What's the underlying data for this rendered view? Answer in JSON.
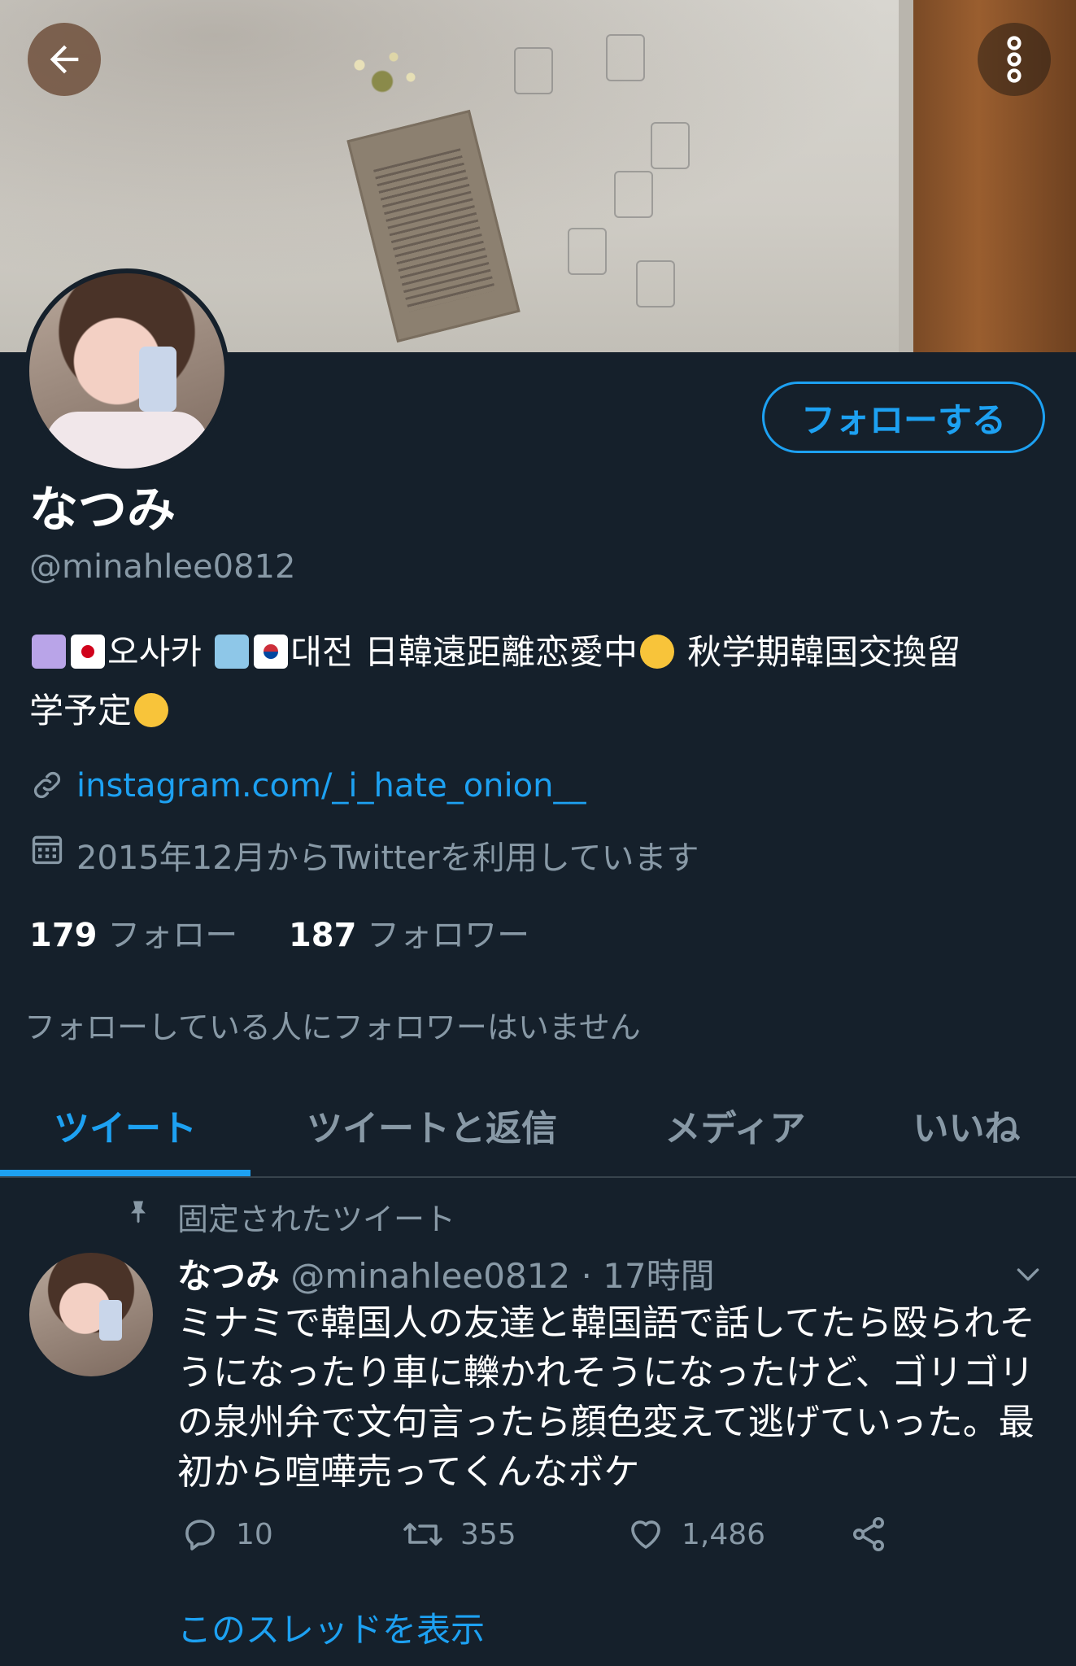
{
  "profile": {
    "name": "なつみ",
    "handle": "@minahlee0812",
    "bio_line1": "오사카 ",
    "bio_line1b": "대전 日韓遠距離恋愛中",
    "bio_line1c": " 秋学期韓国交換留",
    "bio_line2": "学予定",
    "link": "instagram.com/_i_hate_onion__",
    "joined": "2015年12月からTwitterを利用しています",
    "follow_button": "フォローする",
    "following_count": "179",
    "following_label": "フォロー",
    "followers_count": "187",
    "followers_label": "フォロワー",
    "mutual_note": "フォローしている人にフォロワーはいません"
  },
  "tabs": [
    {
      "label": "ツイート"
    },
    {
      "label": "ツイートと返信"
    },
    {
      "label": "メディア"
    },
    {
      "label": "いいね"
    }
  ],
  "tweet": {
    "pinned_label": "固定されたツイート",
    "name": "なつみ",
    "handle_time": " @minahlee0812 · 17時間",
    "text": "ミナミで韓国人の友達と韓国語で話してたら殴られそうになったり車に轢かれそうになったけど、ゴリゴリの泉州弁で文句言ったら顔色変えて逃げていった。最初から喧嘩売ってくんなボケ",
    "replies": "10",
    "retweets": "355",
    "likes": "1,486",
    "show_thread": "このスレッドを表示"
  },
  "colors": {
    "background": "#15202b",
    "accent": "#1da1f2",
    "secondary_text": "#8899a6",
    "divider": "#38444d"
  },
  "icons": [
    "back-arrow-icon",
    "more-vertical-icon",
    "link-icon",
    "calendar-icon",
    "pin-icon",
    "chevron-down-icon",
    "reply-icon",
    "retweet-icon",
    "like-icon",
    "share-icon"
  ]
}
